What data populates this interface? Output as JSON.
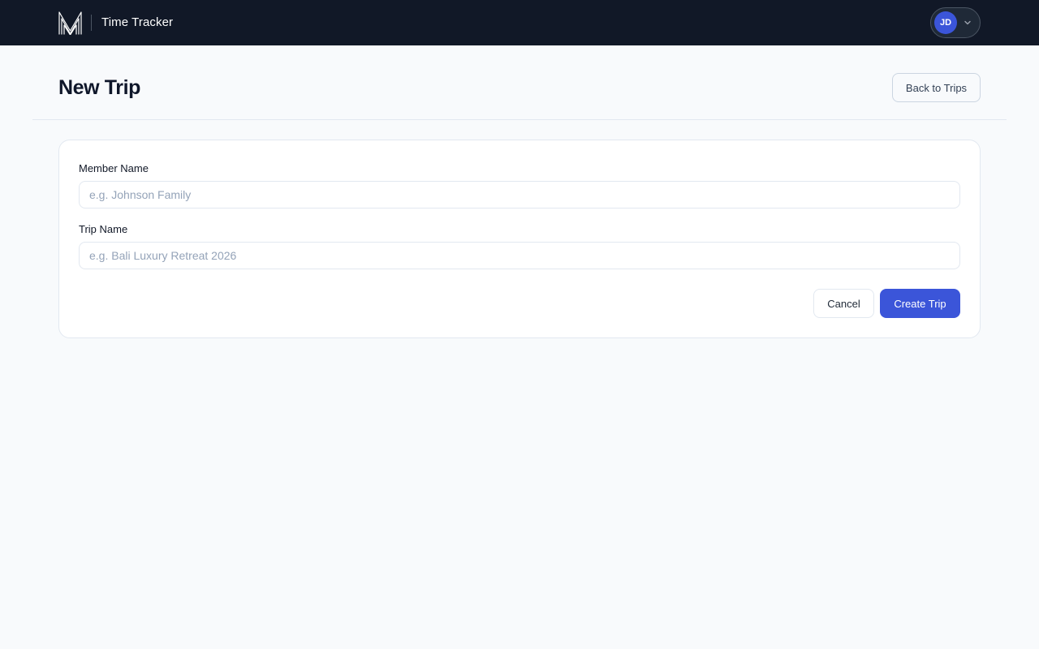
{
  "app": {
    "title": "Time Tracker",
    "logo_icon": "m-monogram-logo-icon"
  },
  "user": {
    "initials": "JD",
    "menu_icon": "chevron-down-icon"
  },
  "page": {
    "title": "New Trip",
    "back_label": "Back to Trips"
  },
  "form": {
    "member_name": {
      "label": "Member Name",
      "value": "",
      "placeholder": "e.g. Johnson Family"
    },
    "trip_name": {
      "label": "Trip Name",
      "value": "",
      "placeholder": "e.g. Bali Luxury Retreat 2026"
    },
    "cancel_label": "Cancel",
    "submit_label": "Create Trip"
  },
  "colors": {
    "topbar": "#111827",
    "accent": "#3b55d9",
    "page_background": "#f8fafc",
    "card_border": "#e2e8f0"
  }
}
